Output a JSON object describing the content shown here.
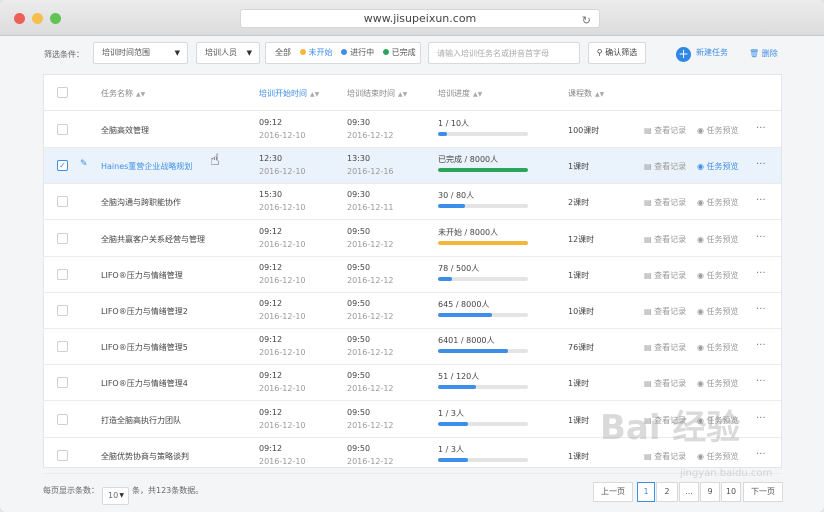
{
  "browser": {
    "url": "www.jisupeixun.com"
  },
  "toolbar": {
    "filter_label": "筛选条件：",
    "time_range": "培训时间范围",
    "trainee": "培训人员",
    "status_all": "全部",
    "statuses": [
      {
        "label": "未开始",
        "color": "#f5b73b"
      },
      {
        "label": "进行中",
        "color": "#3d8ee8"
      },
      {
        "label": "已完成",
        "color": "#2aa55a"
      }
    ],
    "search_placeholder": "请输入培训任务名或拼音首字母",
    "confirm_label": "确认筛选",
    "new_task_label": "新建任务",
    "delete_label": "删除"
  },
  "table": {
    "headers": {
      "name": "任务名称",
      "start": "培训开始时间",
      "end": "培训结束时间",
      "progress": "培训进度",
      "hours": "课程数"
    },
    "action_view": "查看记录",
    "action_preview": "任务预览",
    "more": "···",
    "rows": [
      {
        "name": "全脑高效管理",
        "start_time": "09:12",
        "start_date": "2016-12-10",
        "end_time": "09:30",
        "end_date": "2016-12-12",
        "progress": "1 / 10人",
        "pct": 0.1,
        "color": "#3d8ee8",
        "hours": "100课时"
      },
      {
        "name": "Haines董营企业战略规划",
        "start_time": "12:30",
        "start_date": "2016-12-10",
        "end_time": "13:30",
        "end_date": "2016-12-16",
        "progress": "已完成 / 8000人",
        "pct": 1.0,
        "color": "#2aa55a",
        "hours": "1课时"
      },
      {
        "name": "全脑沟通与跨职能协作",
        "start_time": "15:30",
        "start_date": "2016-12-10",
        "end_time": "09:30",
        "end_date": "2016-12-11",
        "progress": "30 / 80人",
        "pct": 0.3,
        "color": "#3d8ee8",
        "hours": "2课时"
      },
      {
        "name": "全脑共赢客户关系经营与管理",
        "start_time": "09:12",
        "start_date": "2016-12-10",
        "end_time": "09:50",
        "end_date": "2016-12-12",
        "progress": "未开始 / 8000人",
        "pct": 1.0,
        "color": "#f5b73b",
        "hours": "12课时"
      },
      {
        "name": "LIFO®压力与情绪管理",
        "start_time": "09:12",
        "start_date": "2016-12-10",
        "end_time": "09:50",
        "end_date": "2016-12-12",
        "progress": "78 / 500人",
        "pct": 0.16,
        "color": "#3d8ee8",
        "hours": "1课时"
      },
      {
        "name": "LIFO®压力与情绪管理2",
        "start_time": "09:12",
        "start_date": "2016-12-10",
        "end_time": "09:50",
        "end_date": "2016-12-12",
        "progress": "645 / 8000人",
        "pct": 0.6,
        "color": "#3d8ee8",
        "hours": "10课时"
      },
      {
        "name": "LIFO®压力与情绪管理5",
        "start_time": "09:12",
        "start_date": "2016-12-10",
        "end_time": "09:50",
        "end_date": "2016-12-12",
        "progress": "6401 / 8000人",
        "pct": 0.78,
        "color": "#3d8ee8",
        "hours": "76课时"
      },
      {
        "name": "LIFO®压力与情绪管理4",
        "start_time": "09:12",
        "start_date": "2016-12-10",
        "end_time": "09:50",
        "end_date": "2016-12-12",
        "progress": "51 / 120人",
        "pct": 0.42,
        "color": "#3d8ee8",
        "hours": "1课时"
      },
      {
        "name": "打造全脑高执行力团队",
        "start_time": "09:12",
        "start_date": "2016-12-10",
        "end_time": "09:50",
        "end_date": "2016-12-12",
        "progress": "1 / 3人",
        "pct": 0.33,
        "color": "#3d8ee8",
        "hours": "1课时"
      },
      {
        "name": "全脑优势协商与策略谈判",
        "start_time": "09:12",
        "start_date": "2016-12-10",
        "end_time": "09:50",
        "end_date": "2016-12-12",
        "progress": "1 / 3人",
        "pct": 0.33,
        "color": "#3d8ee8",
        "hours": "1课时"
      }
    ]
  },
  "footer": {
    "per_page_label": "每页显示条数：",
    "per_page": "10",
    "total_text": "条，共123条数据。",
    "prev": "上一页",
    "pages": [
      "1",
      "2",
      "...",
      "9",
      "10"
    ],
    "next": "下一页"
  },
  "watermark": {
    "text": "Bai 经验",
    "sub": "jingyan.baidu.com"
  }
}
